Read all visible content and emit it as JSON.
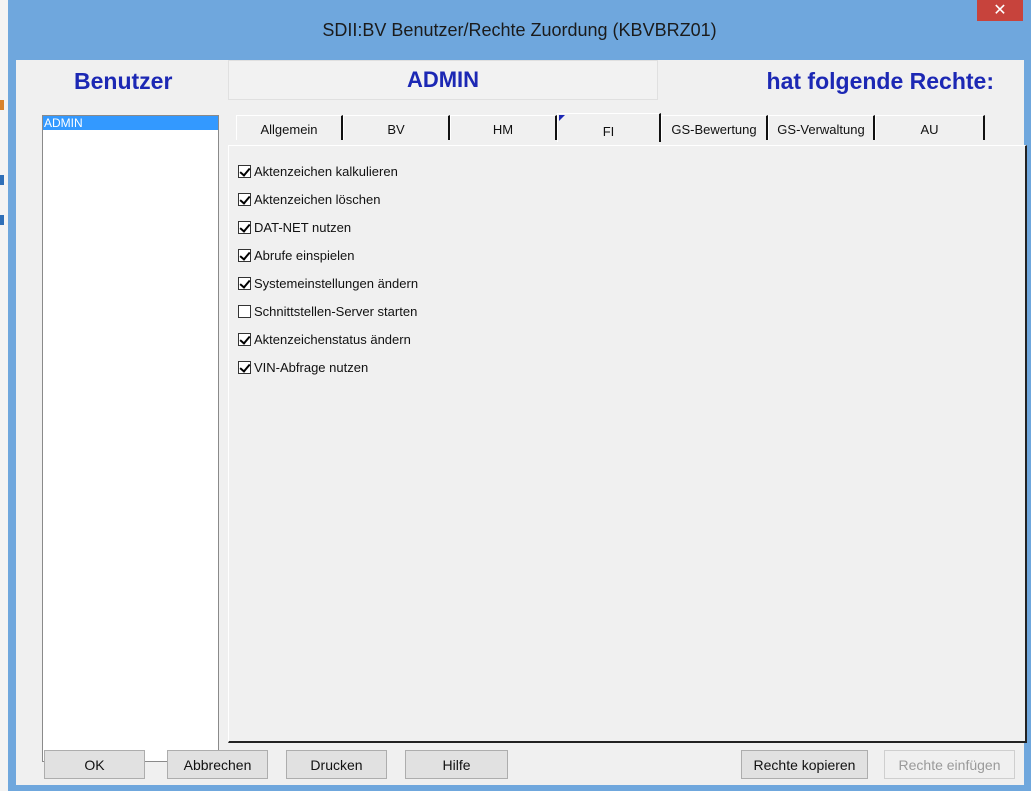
{
  "window": {
    "title": "SDII:BV Benutzer/Rechte Zuordung (KBVBRZ01)",
    "close_glyph": "✕",
    "accent": "#6fa7dd"
  },
  "header": {
    "users_label": "Benutzer",
    "current_user": "ADMIN",
    "rights_label": "hat folgende Rechte:"
  },
  "userlist": {
    "items": [
      {
        "label": "ADMIN",
        "selected": true
      }
    ]
  },
  "tabs": [
    {
      "label": "Allgemein",
      "active": false
    },
    {
      "label": "BV",
      "active": false
    },
    {
      "label": "HM",
      "active": false
    },
    {
      "label": "FI",
      "active": true
    },
    {
      "label": "GS-Bewertung",
      "active": false
    },
    {
      "label": "GS-Verwaltung",
      "active": false
    },
    {
      "label": "AU",
      "active": false
    }
  ],
  "rights": [
    {
      "label": "Aktenzeichen kalkulieren",
      "checked": true
    },
    {
      "label": "Aktenzeichen löschen",
      "checked": true
    },
    {
      "label": "DAT-NET nutzen",
      "checked": true
    },
    {
      "label": "Abrufe einspielen",
      "checked": true
    },
    {
      "label": "Systemeinstellungen ändern",
      "checked": true
    },
    {
      "label": "Schnittstellen-Server starten",
      "checked": false
    },
    {
      "label": "Aktenzeichenstatus ändern",
      "checked": true
    },
    {
      "label": "VIN-Abfrage nutzen",
      "checked": true
    }
  ],
  "buttons": {
    "ok": "OK",
    "cancel": "Abbrechen",
    "print": "Drucken",
    "help": "Hilfe",
    "copy_rights": "Rechte kopieren",
    "paste_rights": "Rechte einfügen"
  }
}
